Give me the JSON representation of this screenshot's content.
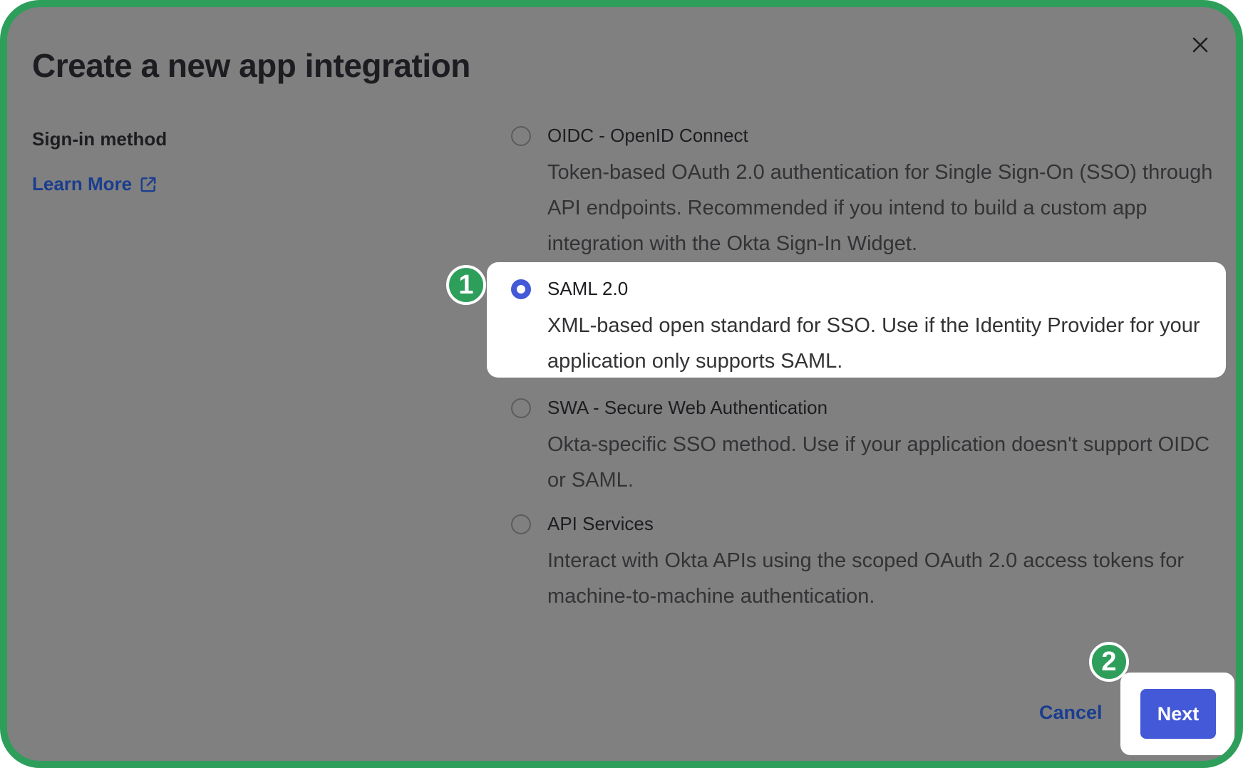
{
  "dialog": {
    "title": "Create a new app integration",
    "close_icon": "close-icon"
  },
  "sidebar": {
    "section_label": "Sign-in method",
    "learn_more": "Learn More",
    "learn_more_icon": "external-link-icon"
  },
  "options": [
    {
      "title": "OIDC - OpenID Connect",
      "description": "Token-based OAuth 2.0 authentication for Single Sign-On (SSO) through API endpoints. Recommended if you intend to build a custom app integration with the Okta Sign-In Widget.",
      "selected": false
    },
    {
      "title": "SAML 2.0",
      "description": "XML-based open standard for SSO. Use if the Identity Provider for your application only supports SAML.",
      "selected": true
    },
    {
      "title": "SWA - Secure Web Authentication",
      "description": "Okta-specific SSO method. Use if your application doesn't support OIDC or SAML.",
      "selected": false
    },
    {
      "title": "API Services",
      "description": "Interact with Okta APIs using the scoped OAuth 2.0 access tokens for machine-to-machine authentication.",
      "selected": false
    }
  ],
  "steps": {
    "step1": "1",
    "step2": "2"
  },
  "footer": {
    "cancel_label": "Cancel",
    "next_label": "Next"
  },
  "colors": {
    "accent": "#4459d8",
    "link": "#1a3d8f",
    "badge": "#2e9e5b",
    "overlay": "#808080"
  }
}
